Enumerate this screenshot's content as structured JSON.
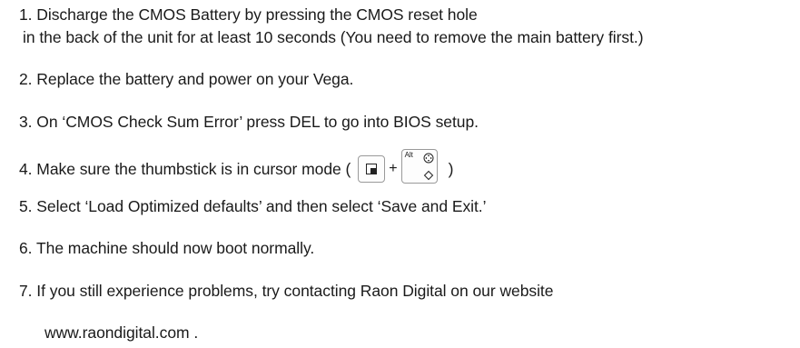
{
  "instructions": {
    "step1_line1": "1. Discharge the CMOS Battery by pressing the CMOS reset hole",
    "step1_line2": "in the back of the unit for at least 10 seconds (You need to remove the main battery first.)",
    "step2": "2. Replace the battery and power on your Vega.",
    "step3": "3. On ‘CMOS Check Sum Error’ press DEL to go into BIOS setup.",
    "step4_prefix": "4. Make sure the thumbstick is in cursor mode (",
    "step4_plus": "+",
    "step4_key_alt_label": "Alt",
    "step4_suffix": ")",
    "step5": "5. Select ‘Load Optimized defaults’ and then select ‘Save and Exit.’",
    "step6": "6. The machine should now boot normally.",
    "step7": "7. If you still experience problems, try contacting Raon Digital on our website",
    "website": "www.raondigital.com ."
  },
  "icons": {
    "key1": "window-square-key-icon",
    "key2": "alt-thumbstick-key-icon"
  }
}
